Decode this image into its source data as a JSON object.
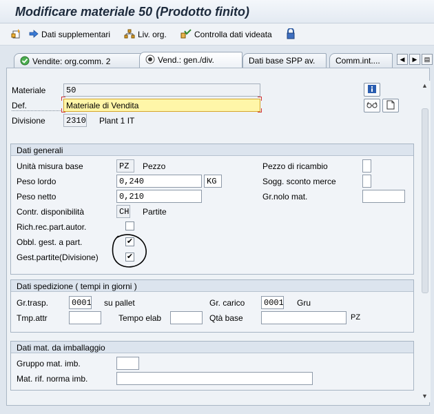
{
  "window": {
    "title": "Modificare materiale 50 (Prodotto finito)"
  },
  "toolbar": {
    "additional_data": "Dati supplementari",
    "org_levels": "Liv. org.",
    "check_screen_data": "Controlla dati videata"
  },
  "tabs": [
    {
      "label": "Vendite: org.comm. 2",
      "icon": "check-icon"
    },
    {
      "label": "Vend.: gen./div.",
      "icon": "radio-icon"
    },
    {
      "label": "Dati base SPP av.",
      "icon": ""
    },
    {
      "label": "Comm.int....",
      "icon": ""
    }
  ],
  "header": {
    "material_label": "Materiale",
    "material_value": "50",
    "description_label": "Def.",
    "description_value": "Materiale di Vendita",
    "plant_label": "Divisione",
    "plant_value": "2310",
    "plant_text": "Plant 1 IT"
  },
  "general": {
    "title": "Dati generali",
    "base_uom_label": "Unità misura base",
    "base_uom_value": "PZ",
    "base_uom_text": "Pezzo",
    "gross_weight_label": "Peso lordo",
    "gross_weight_value": "0,240",
    "weight_unit": "KG",
    "net_weight_label": "Peso netto",
    "net_weight_value": "0,210",
    "availability_label": "Contr. disponibilità",
    "availability_value": "CH",
    "availability_text": "Partite",
    "batch_rec_label": "Rich.rec.part.autor.",
    "batch_rec_checked": false,
    "batch_mgmt_label": "Obbl. gest. a part.",
    "batch_mgmt_checked": true,
    "batch_plant_label": "Gest.partite(Divisione)",
    "batch_plant_checked": true,
    "spare_part_label": "Pezzo di ricambio",
    "discount_label": "Sogg. sconto merce",
    "freight_group_label": "Gr.nolo mat."
  },
  "shipping": {
    "title": "Dati spedizione ( tempi in giorni )",
    "trans_group_label": "Gr.trasp.",
    "trans_group_value": "0001",
    "trans_group_text": "su pallet",
    "loading_group_label": "Gr. carico",
    "loading_group_value": "0001",
    "loading_group_text": "Gru",
    "setup_time_label": "Tmp.attr",
    "proc_time_label": "Tempo elab",
    "base_qty_label": "Qtà base",
    "base_qty_unit": "PZ"
  },
  "packaging": {
    "title": "Dati mat. da imballaggio",
    "pack_group_label": "Gruppo mat. imb.",
    "ref_material_label": "Mat. rif. norma imb."
  },
  "colors": {
    "required_field": "#fff6a8",
    "background": "#dfe6ee",
    "annotation": "#000000"
  }
}
